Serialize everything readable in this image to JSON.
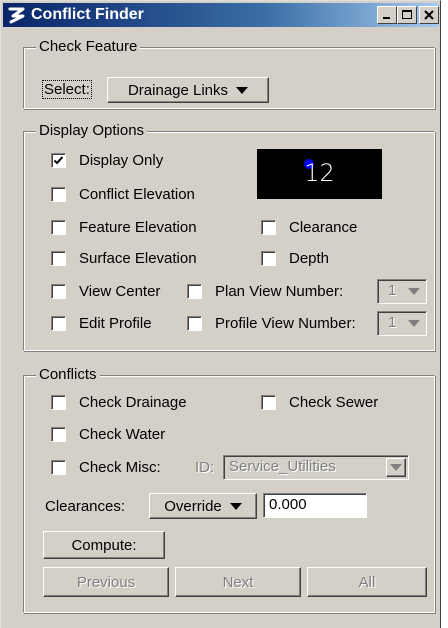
{
  "window": {
    "title": "Conflict Finder",
    "controls": [
      "minimize",
      "maximize",
      "close"
    ]
  },
  "check_feature": {
    "legend": "Check Feature",
    "select_label": "Select:",
    "selected": "Drainage Links"
  },
  "display_options": {
    "legend": "Display Options",
    "display_only": {
      "label": "Display Only",
      "checked": true
    },
    "conflict_elevation": {
      "label": "Conflict Elevation",
      "checked": false
    },
    "feature_elevation": {
      "label": "Feature Elevation",
      "checked": false
    },
    "clearance": {
      "label": "Clearance",
      "checked": false
    },
    "surface_elevation": {
      "label": "Surface Elevation",
      "checked": false
    },
    "depth": {
      "label": "Depth",
      "checked": false
    },
    "view_center": {
      "label": "View Center",
      "checked": false
    },
    "plan_view": {
      "label": "Plan View Number:",
      "checked": false,
      "value": "1"
    },
    "edit_profile": {
      "label": "Edit Profile",
      "checked": false
    },
    "profile_view": {
      "label": "Profile View Number:",
      "checked": false,
      "value": "1"
    },
    "display_value": "12",
    "dot_color": "#0000ff"
  },
  "conflicts": {
    "legend": "Conflicts",
    "check_drainage": {
      "label": "Check Drainage",
      "checked": false
    },
    "check_sewer": {
      "label": "Check Sewer",
      "checked": false
    },
    "check_water": {
      "label": "Check Water",
      "checked": false
    },
    "check_misc": {
      "label": "Check Misc:",
      "checked": false
    },
    "id_label": "ID:",
    "id_value": "Service_Utilities",
    "clearances_label": "Clearances:",
    "clearances_mode": "Override",
    "clearances_value": "0.000",
    "compute_label": "Compute:",
    "previous_label": "Previous",
    "next_label": "Next",
    "all_label": "All"
  },
  "colors": {
    "titlebar_start": "#0a246a",
    "titlebar_end": "#a6caf0",
    "face": "#d4d0c8"
  }
}
